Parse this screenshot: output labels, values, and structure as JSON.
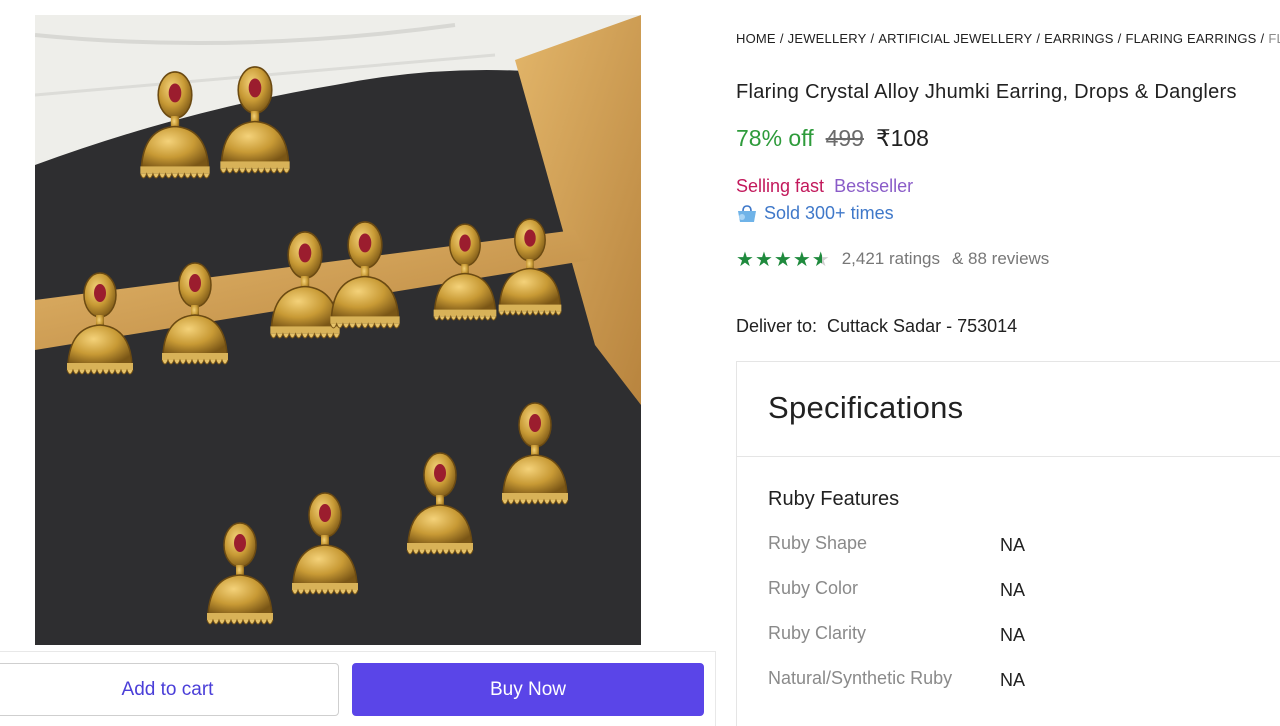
{
  "breadcrumb": [
    "HOME",
    "JEWELLERY",
    "ARTIFICIAL JEWELLERY",
    "EARRINGS",
    "FLARING EARRINGS",
    "FLAR"
  ],
  "product": {
    "title": "Flaring Crystal Alloy Jhumki Earring, Drops & Danglers",
    "discount": "78% off",
    "mrp": "499",
    "price": "₹108",
    "selling_fast": "Selling fast",
    "bestseller": "Bestseller",
    "sold": "Sold 300+ times",
    "rating_value": 4.5,
    "ratings": "2,421 ratings",
    "reviews": "& 88 reviews"
  },
  "delivery": {
    "label": "Deliver to:",
    "location": "Cuttack Sadar - 753014"
  },
  "actions": {
    "add_to_cart": "Add to cart",
    "buy_now": "Buy Now"
  },
  "specifications": {
    "title": "Specifications",
    "section": "Ruby Features",
    "rows": [
      {
        "key": "Ruby Shape",
        "value": "NA"
      },
      {
        "key": "Ruby Color",
        "value": "NA"
      },
      {
        "key": "Ruby Clarity",
        "value": "NA"
      },
      {
        "key": "Natural/Synthetic Ruby",
        "value": "NA"
      }
    ]
  },
  "colors": {
    "accent": "#5a45e8",
    "discount": "#2e9b3b",
    "star": "#1f8a3d",
    "selling_fast": "#c2185b",
    "bestseller": "#8a5cc8",
    "sold": "#3f78c9"
  },
  "icons": {
    "sold": "shopping-bag-icon",
    "rating": "star-icon"
  }
}
